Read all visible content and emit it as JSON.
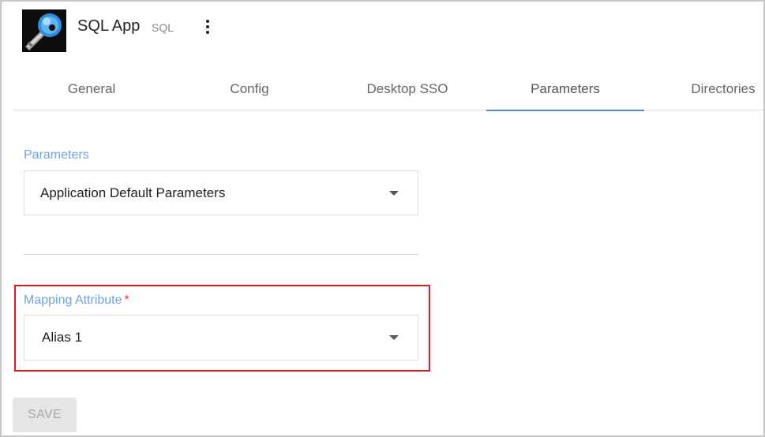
{
  "app": {
    "title": "SQL App",
    "type": "SQL",
    "icon": "key-icon"
  },
  "tabs": [
    {
      "label": "General"
    },
    {
      "label": "Config"
    },
    {
      "label": "Desktop SSO"
    },
    {
      "label": "Parameters",
      "active": true
    },
    {
      "label": "Directories"
    }
  ],
  "form": {
    "parameters": {
      "label": "Parameters",
      "value": "Application Default Parameters"
    },
    "mapping_attribute": {
      "label": "Mapping Attribute",
      "required_mark": "*",
      "value": "Alias 1"
    },
    "save_label": "SAVE"
  },
  "colors": {
    "accent": "#4a90d9",
    "label": "#6aa4e6",
    "highlight_border": "#e01a1a"
  }
}
